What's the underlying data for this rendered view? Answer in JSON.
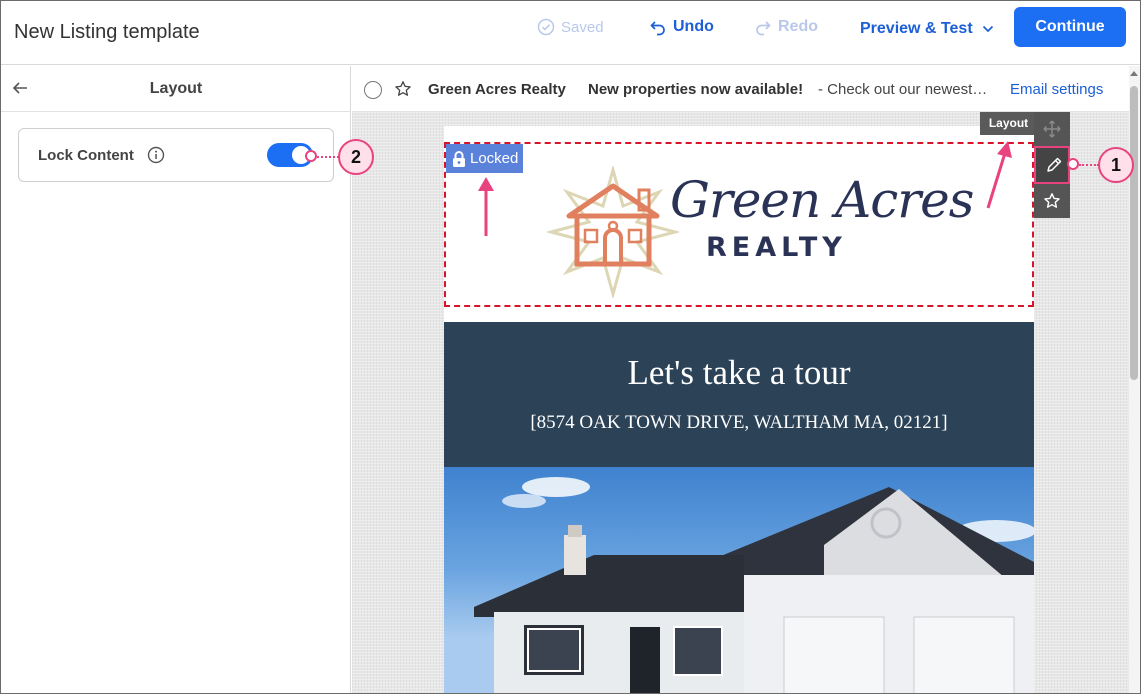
{
  "window": {
    "title": "New Listing template"
  },
  "toolbar": {
    "saved_label": "Saved",
    "undo_label": "Undo",
    "redo_label": "Redo",
    "preview_label": "Preview & Test",
    "continue_label": "Continue"
  },
  "left_panel": {
    "title": "Layout",
    "lock_content_label": "Lock Content",
    "lock_enabled": true
  },
  "email_header": {
    "sender": "Green Acres Realty",
    "subject": "New properties now available!",
    "preview_text": "- Check out our newest…",
    "settings_link": "Email settings"
  },
  "email_content": {
    "locked_badge": "Locked",
    "logo_line1": "Green Acres",
    "logo_line2": "REALTY",
    "tour_title": "Let's take a tour",
    "tour_address": "[8574 OAK TOWN DRIVE, WALTHAM MA, 02121]"
  },
  "block_toolbar": {
    "tooltip": "Layout",
    "icons": [
      "move-icon",
      "pencil-icon",
      "star-icon"
    ]
  },
  "callouts": [
    "1",
    "2"
  ],
  "colors": {
    "primary": "#1c6ef2",
    "link": "#1c5fd6",
    "lock_badge": "#5b82db",
    "locked_outline": "#d6142a",
    "callout": "#e8437f",
    "tour_background": "#2c4257",
    "logo_text": "#2a3356",
    "logo_house": "#e0805e"
  }
}
